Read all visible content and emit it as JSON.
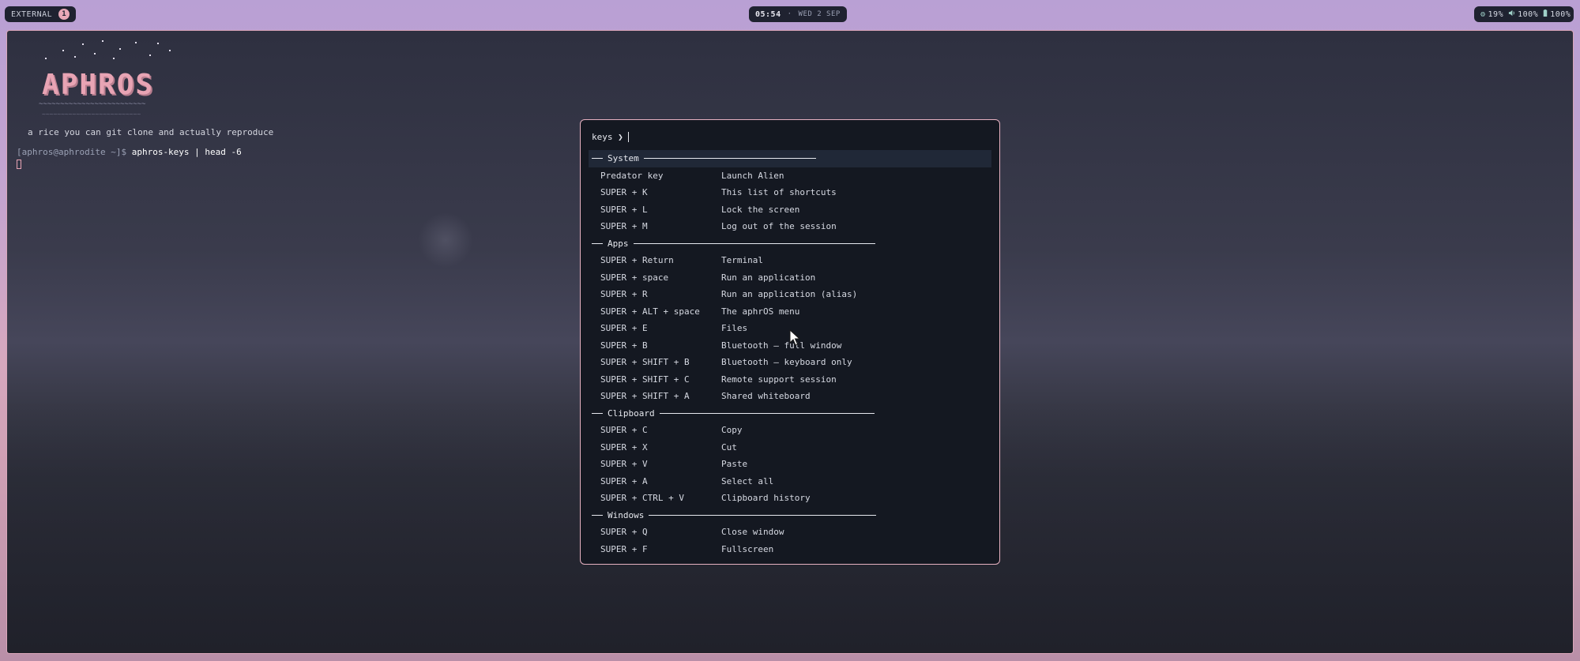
{
  "topbar": {
    "workspace_label": "EXTERNAL",
    "workspace_count": "1",
    "clock_time": "05:54",
    "clock_sep": "·",
    "clock_date": "WED 2 SEP",
    "tray": [
      {
        "icon": "cpu-icon",
        "glyph": "⚙",
        "value": "19%"
      },
      {
        "icon": "volume-icon",
        "glyph": "🔊",
        "value": "100%"
      },
      {
        "icon": "battery-icon",
        "glyph": "▮",
        "value": "100%"
      }
    ]
  },
  "terminal": {
    "logo_text": "APHROS",
    "logo_wave": "~~~~~~~~~~~~~~~~~~~~~~~~~",
    "logo_wave2": "~~~~~~~~~~~~~~~~~~~~~~~~~~",
    "tagline": "a rice you can git clone and actually reproduce",
    "prompt": "[aphros@aphrodite ~]$ ",
    "command": "aphros-keys | head -6"
  },
  "launcher": {
    "prompt": "keys ❯",
    "sections": [
      {
        "title": "System",
        "rule_width": 218,
        "selected": true,
        "rows": [
          {
            "key": "Predator key",
            "desc": "Launch Alien"
          },
          {
            "key": "SUPER + K",
            "desc": "This list of shortcuts"
          },
          {
            "key": "SUPER + L",
            "desc": "Lock the screen"
          },
          {
            "key": "SUPER + M",
            "desc": "Log out of the session"
          }
        ]
      },
      {
        "title": "Apps",
        "rule_width": 306,
        "selected": false,
        "rows": [
          {
            "key": "SUPER + Return",
            "desc": "Terminal"
          },
          {
            "key": "SUPER + space",
            "desc": "Run an application"
          },
          {
            "key": "SUPER + R",
            "desc": "Run an application (alias)"
          },
          {
            "key": "SUPER + ALT + space",
            "desc": "The aphrOS menu"
          },
          {
            "key": "SUPER + E",
            "desc": "Files"
          },
          {
            "key": "SUPER + B",
            "desc": "Bluetooth — full window"
          },
          {
            "key": "SUPER + SHIFT + B",
            "desc": "Bluetooth — keyboard only"
          },
          {
            "key": "SUPER + SHIFT + C",
            "desc": "Remote support session"
          },
          {
            "key": "SUPER + SHIFT + A",
            "desc": "Shared whiteboard"
          }
        ]
      },
      {
        "title": "Clipboard",
        "rule_width": 272,
        "selected": false,
        "rows": [
          {
            "key": "SUPER + C",
            "desc": "Copy"
          },
          {
            "key": "SUPER + X",
            "desc": "Cut"
          },
          {
            "key": "SUPER + V",
            "desc": "Paste"
          },
          {
            "key": "SUPER + A",
            "desc": "Select all"
          },
          {
            "key": "SUPER + CTRL + V",
            "desc": "Clipboard history"
          }
        ]
      },
      {
        "title": "Windows",
        "rule_width": 288,
        "selected": false,
        "rows": [
          {
            "key": "SUPER + Q",
            "desc": "Close window"
          },
          {
            "key": "SUPER + F",
            "desc": "Fullscreen"
          }
        ]
      }
    ]
  }
}
